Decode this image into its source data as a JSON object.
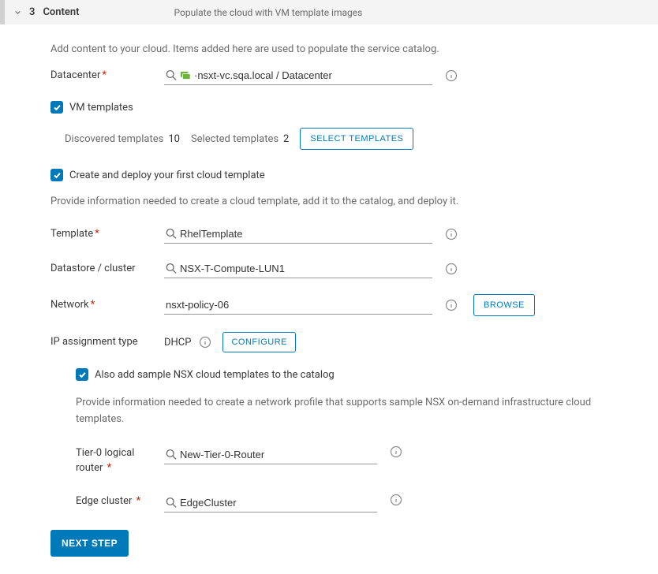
{
  "header": {
    "step_number": "3",
    "step_title": "Content",
    "subtitle": "Populate the cloud with VM template images"
  },
  "intro": "Add content to your cloud. Items added here are used to populate the service catalog.",
  "datacenter": {
    "label": "Datacenter",
    "value": "·nsxt-vc.sqa.local / Datacenter"
  },
  "vm_templates": {
    "label": "VM templates",
    "discovered_label": "Discovered templates",
    "discovered_count": "10",
    "selected_label": "Selected templates",
    "selected_count": "2",
    "select_btn": "SELECT TEMPLATES"
  },
  "create_deploy": {
    "label": "Create and deploy your first cloud template",
    "desc": "Provide information needed to create a cloud template, add it to the catalog, and deploy it."
  },
  "template": {
    "label": "Template",
    "value": "RhelTemplate"
  },
  "datastore": {
    "label": "Datastore / cluster",
    "value": "NSX-T-Compute-LUN1"
  },
  "network": {
    "label": "Network",
    "value": "nsxt-policy-06",
    "browse_btn": "BROWSE"
  },
  "ip_assignment": {
    "label": "IP assignment type",
    "value": "DHCP",
    "configure_btn": "CONFIGURE"
  },
  "nsx_samples": {
    "label": "Also add sample NSX cloud templates to the catalog",
    "desc": "Provide information needed to create a network profile that supports sample NSX on-demand infrastructure cloud templates."
  },
  "tier0": {
    "label": "Tier-0 logical router",
    "value": "New-Tier-0-Router"
  },
  "edge_cluster": {
    "label": "Edge cluster",
    "value": "EdgeCluster"
  },
  "next_btn": "NEXT STEP"
}
